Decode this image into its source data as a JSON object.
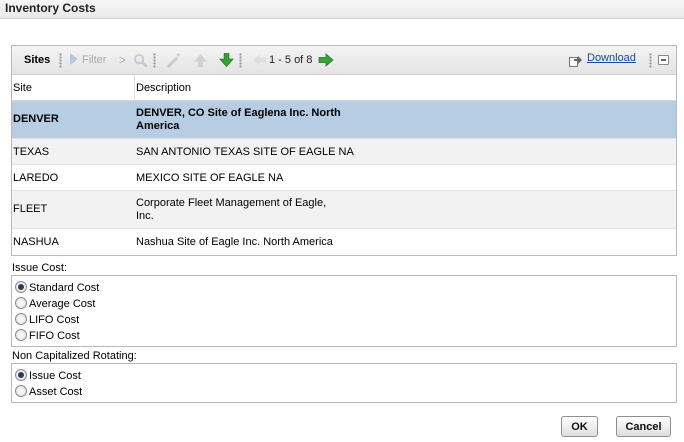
{
  "dialog": {
    "title": "Inventory Costs"
  },
  "toolbar": {
    "title": "Sites",
    "filter_label": "Filter",
    "chevron": ">",
    "range": "1 - 5 of 8",
    "download_label": "Download"
  },
  "table": {
    "columns": [
      "Site",
      "Description"
    ],
    "rows": [
      {
        "site": "DENVER",
        "description": "DENVER, CO Site of Eaglena Inc. North America",
        "selected": true
      },
      {
        "site": "TEXAS",
        "description": "SAN ANTONIO TEXAS SITE OF EAGLE NA",
        "selected": false
      },
      {
        "site": "LAREDO",
        "description": "MEXICO SITE OF EAGLE NA",
        "selected": false
      },
      {
        "site": "FLEET",
        "description": "Corporate Fleet Management of Eagle, Inc.",
        "selected": false
      },
      {
        "site": "NASHUA",
        "description": "Nashua Site of Eagle Inc. North America",
        "selected": false
      }
    ]
  },
  "issue_cost": {
    "label": "Issue Cost:",
    "options": [
      "Standard Cost",
      "Average Cost",
      "LIFO Cost",
      "FIFO Cost"
    ],
    "selected": "Standard Cost"
  },
  "non_cap_rotating": {
    "label": "Non Capitalized Rotating:",
    "options": [
      "Issue Cost",
      "Asset Cost"
    ],
    "selected": "Issue Cost"
  },
  "buttons": {
    "ok": "OK",
    "cancel": "Cancel"
  },
  "colors": {
    "selected_row": "#b7cde4",
    "link": "#1b48a6",
    "arrow_green": "#3aa23a"
  }
}
